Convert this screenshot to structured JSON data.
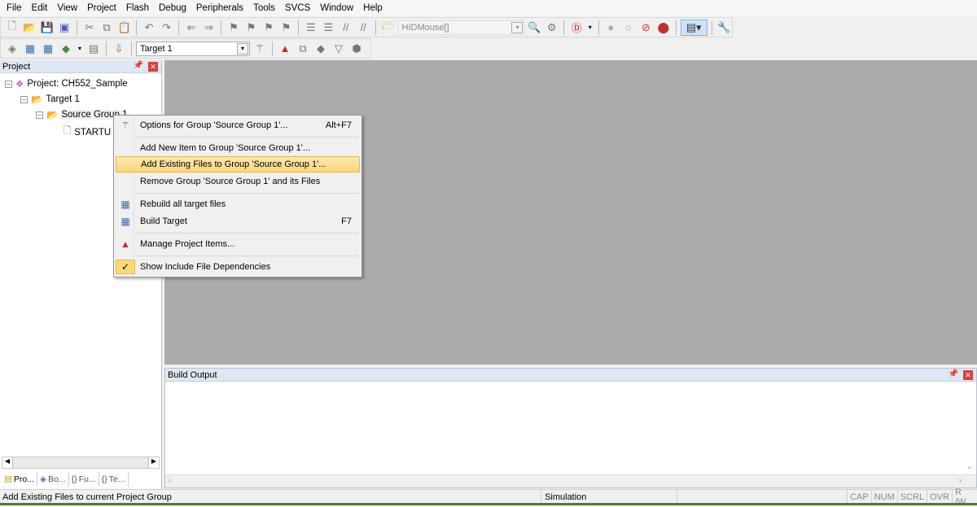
{
  "menubar": [
    "File",
    "Edit",
    "View",
    "Project",
    "Flash",
    "Debug",
    "Peripherals",
    "Tools",
    "SVCS",
    "Window",
    "Help"
  ],
  "toolbar1": {
    "find_combo": "HIDMouse[]"
  },
  "toolbar2": {
    "target_combo": "Target 1"
  },
  "project_panel": {
    "title": "Project",
    "tree": {
      "project": "Project: CH552_Sample",
      "target": "Target 1",
      "group": "Source Group 1",
      "file": "STARTU"
    },
    "tabs": [
      "Pro...",
      "Bo...",
      "Fu...",
      "Te..."
    ]
  },
  "context_menu": {
    "items": [
      {
        "label": "Options for Group 'Source Group 1'...",
        "shortcut": "Alt+F7",
        "icon": "options-wand-icon"
      },
      {
        "label": "Add New  Item to Group 'Source Group 1'...",
        "shortcut": ""
      },
      {
        "label": "Add Existing Files to Group 'Source Group 1'...",
        "shortcut": "",
        "highlighted": true
      },
      {
        "label": "Remove Group 'Source Group 1' and its Files",
        "shortcut": ""
      },
      {
        "label": "Rebuild all target files",
        "shortcut": "",
        "icon": "rebuild-icon"
      },
      {
        "label": "Build Target",
        "shortcut": "F7",
        "icon": "build-icon"
      },
      {
        "label": "Manage Project Items...",
        "shortcut": "",
        "icon": "manage-items-icon"
      },
      {
        "label": "Show Include File Dependencies",
        "shortcut": "",
        "icon": "checkmark-icon",
        "checked": true
      }
    ]
  },
  "build_output": {
    "title": "Build Output"
  },
  "status": {
    "message": "Add Existing Files to current Project Group",
    "mode": "Simulation",
    "indicators": [
      "CAP",
      "NUM",
      "SCRL",
      "OVR",
      "R /W"
    ]
  },
  "colors": {
    "workspace": "#ababab",
    "highlight": "#fbd77a",
    "panel_header": "#dfe7f2"
  }
}
